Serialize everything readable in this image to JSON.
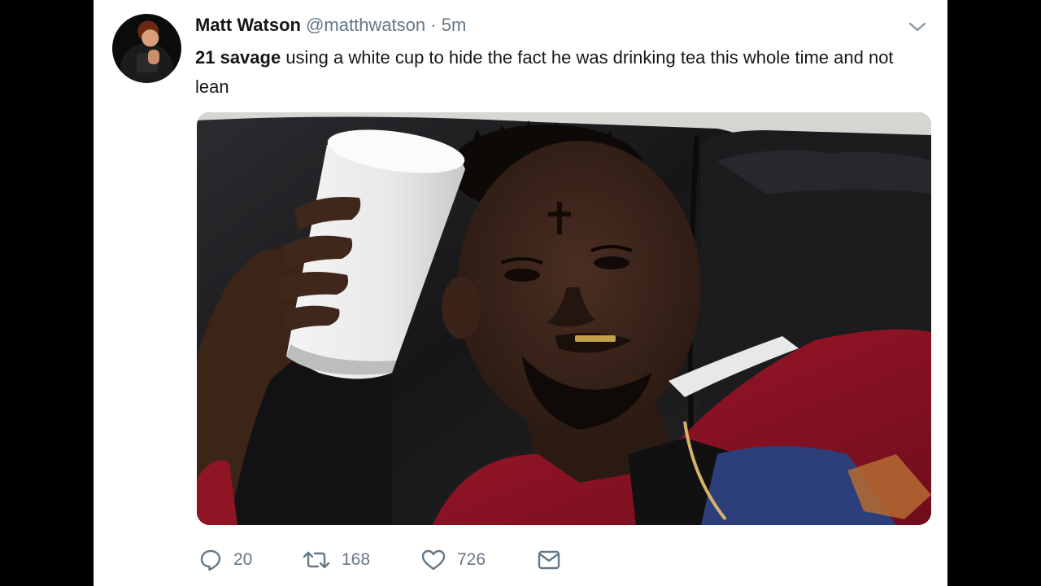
{
  "tweet": {
    "author": {
      "display_name": "Matt Watson",
      "handle": "@matthwatson",
      "avatar_icon": "profile-photo"
    },
    "separator": "·",
    "timestamp": "5m",
    "menu_icon": "chevron-down-icon",
    "text": {
      "bold_part": "21 savage",
      "rest": " using a white cup to hide the fact he was drinking tea this whole time and not lean"
    },
    "media": {
      "description_icon": "photo"
    },
    "actions": {
      "reply_count": "20",
      "retweet_count": "168",
      "like_count": "726"
    }
  },
  "colors": {
    "text_primary": "#14171a",
    "text_secondary": "#657786",
    "background": "#ffffff",
    "frame": "#000000"
  }
}
